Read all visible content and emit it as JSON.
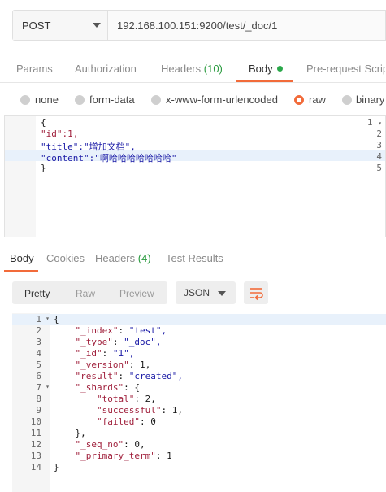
{
  "request": {
    "method": "POST",
    "url": "192.168.100.151:9200/test/_doc/1"
  },
  "request_tabs": [
    {
      "label": "Params"
    },
    {
      "label": "Authorization"
    },
    {
      "label": "Headers",
      "count": "(10)"
    },
    {
      "label": "Body"
    },
    {
      "label": "Pre-request Scrip"
    }
  ],
  "body_types": [
    "none",
    "form-data",
    "x-www-form-urlencoded",
    "raw",
    "binary"
  ],
  "selected_body_type": "raw",
  "request_body": {
    "line_numbers": [
      "1",
      "2",
      "3",
      "4",
      "5"
    ],
    "lines": [
      "{",
      "\"id\":1,",
      "\"title\":\"增加文档\",",
      "\"content\":\"啊哈哈哈哈哈哈哈\"",
      "}"
    ]
  },
  "response_tabs": [
    {
      "label": "Body"
    },
    {
      "label": "Cookies"
    },
    {
      "label": "Headers",
      "count": "(4)"
    },
    {
      "label": "Test Results"
    }
  ],
  "view_modes": [
    "Pretty",
    "Raw",
    "Preview"
  ],
  "format": "JSON",
  "response_body": {
    "line_numbers": [
      "1",
      "2",
      "3",
      "4",
      "5",
      "6",
      "7",
      "8",
      "9",
      "10",
      "11",
      "12",
      "13",
      "14"
    ],
    "lines": [
      "{",
      "    \"_index\": \"test\",",
      "    \"_type\": \"_doc\",",
      "    \"_id\": \"1\",",
      "    \"_version\": 1,",
      "    \"result\": \"created\",",
      "    \"_shards\": {",
      "        \"total\": 2,",
      "        \"successful\": 1,",
      "        \"failed\": 0",
      "    },",
      "    \"_seq_no\": 0,",
      "    \"_primary_term\": 1",
      "}"
    ]
  },
  "colors": {
    "accent": "#f26b3a",
    "success": "#2aa84a",
    "key": "#a0203c",
    "string": "#1a1aa6"
  }
}
